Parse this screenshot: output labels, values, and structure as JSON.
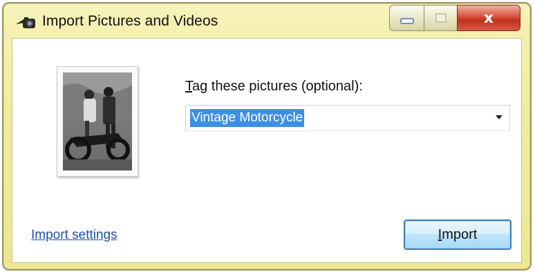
{
  "window": {
    "title": "Import Pictures and Videos",
    "close_glyph": "x"
  },
  "icons": {
    "app": "camera-import-icon",
    "minimize": "minimize-icon",
    "maximize": "maximize-icon",
    "close": "close-icon",
    "dropdown": "chevron-down-icon"
  },
  "preview": {
    "description_icon": "photo-thumbnail"
  },
  "tag": {
    "label_accesskey": "T",
    "label_rest": "ag these pictures (optional):",
    "value": "Vintage Motorcycle"
  },
  "footer": {
    "settings_link": "Import settings",
    "import_accesskey": "I",
    "import_rest": "mport"
  },
  "colors": {
    "titlebar": "#f2ec9c",
    "close_button": "#c0311a",
    "link": "#1e4fa8",
    "selection": "#3d8ee6",
    "button_border": "#3c7fb1"
  }
}
